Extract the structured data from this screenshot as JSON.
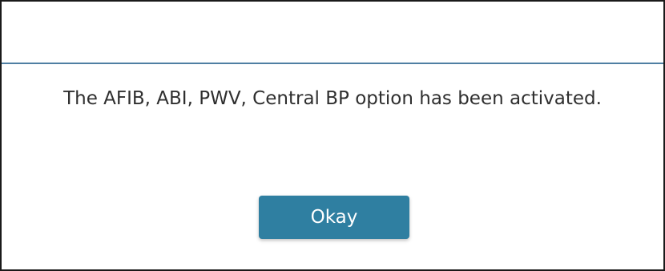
{
  "dialog": {
    "message": "The AFIB, ABI, PWV, Central BP option has been activated.",
    "okay_label": "Okay"
  },
  "colors": {
    "divider": "#4f7fa3",
    "button_bg": "#2f7fa1",
    "button_text": "#ffffff",
    "message_text": "#2f2f2f",
    "border": "#1a1a1a"
  }
}
